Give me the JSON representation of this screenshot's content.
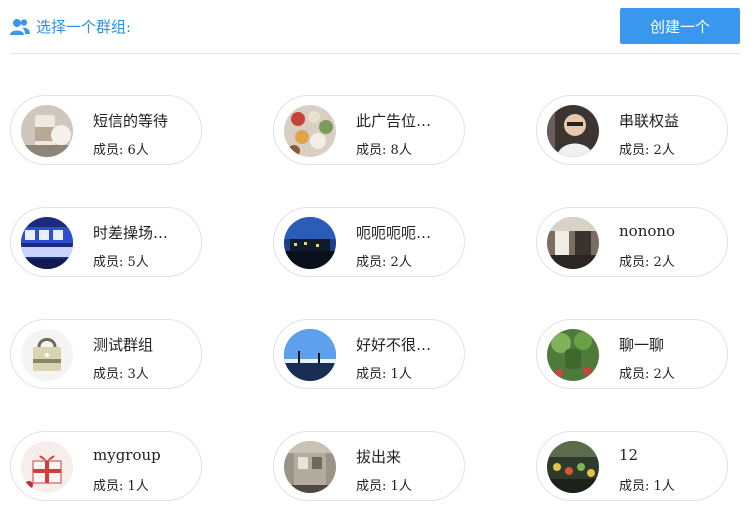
{
  "header": {
    "title": "选择一个群组:",
    "create_label": "创建一个",
    "accent": "#3a97ee"
  },
  "member_prefix": "成员:",
  "groups": [
    {
      "name": "短信的等待",
      "count": "6人",
      "avatar": "drink-photo"
    },
    {
      "name": "此广告位…",
      "count": "8人",
      "avatar": "food-photo"
    },
    {
      "name": "串联权益",
      "count": "2人",
      "avatar": "person-photo"
    },
    {
      "name": "时差操场…",
      "count": "5人",
      "avatar": "poster-photo"
    },
    {
      "name": "呃呃呃呃…",
      "count": "2人",
      "avatar": "night-city-photo"
    },
    {
      "name": "nonono",
      "count": "2人",
      "avatar": "room-photo"
    },
    {
      "name": "测试群组",
      "count": "3人",
      "avatar": "bag-photo"
    },
    {
      "name": "好好不很…",
      "count": "1人",
      "avatar": "sky-photo"
    },
    {
      "name": "聊一聊",
      "count": "2人",
      "avatar": "plant-photo"
    },
    {
      "name": "mygroup",
      "count": "1人",
      "avatar": "gift-photo"
    },
    {
      "name": "拔出来",
      "count": "1人",
      "avatar": "wall-photo"
    },
    {
      "name": "12",
      "count": "1人",
      "avatar": "market-photo"
    }
  ]
}
